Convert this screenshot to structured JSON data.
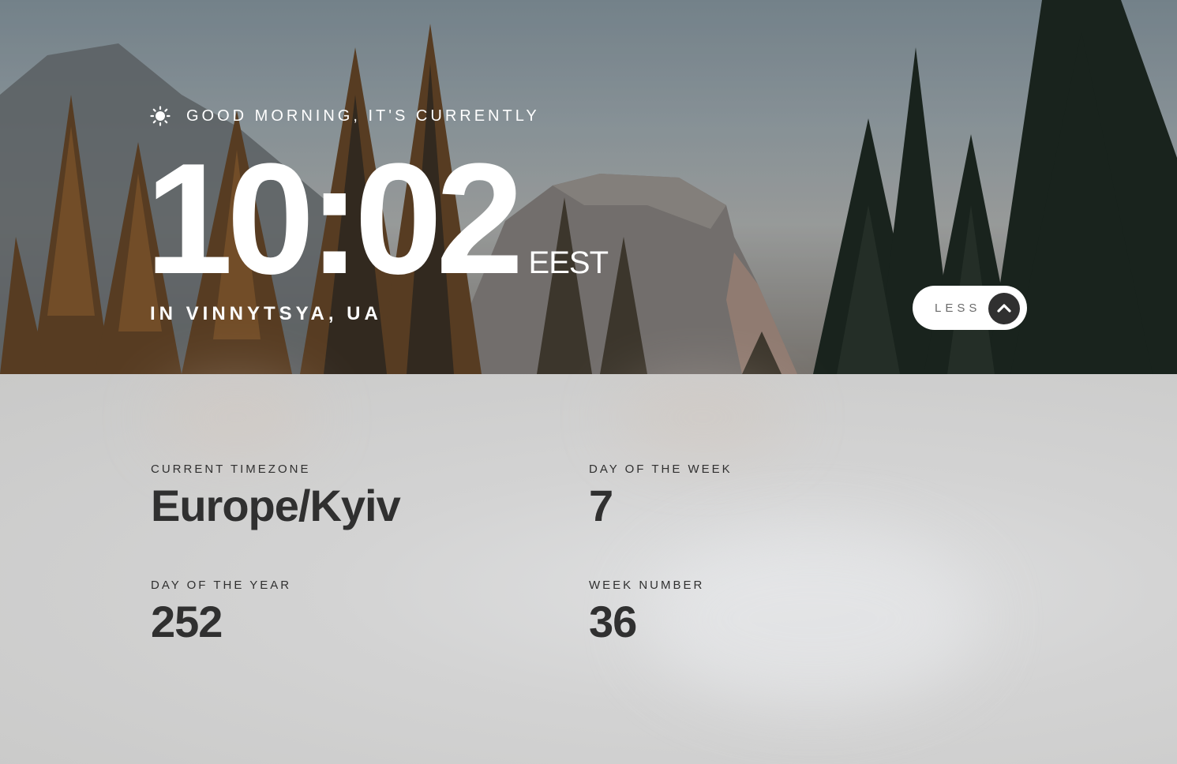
{
  "greeting": {
    "icon": "sun-icon",
    "text": "GOOD MORNING, IT'S CURRENTLY"
  },
  "clock": {
    "time": "10:02",
    "abbreviation": "EEST"
  },
  "location": "IN VINNYTSYA, UA",
  "toggle": {
    "label": "LESS",
    "icon": "chevron-up-icon"
  },
  "details": {
    "timezone": {
      "label": "CURRENT TIMEZONE",
      "value": "Europe/Kyiv"
    },
    "day_of_week": {
      "label": "DAY OF THE WEEK",
      "value": "7"
    },
    "day_of_year": {
      "label": "DAY OF THE YEAR",
      "value": "252"
    },
    "week_number": {
      "label": "WEEK NUMBER",
      "value": "36"
    }
  },
  "colors": {
    "text_light": "#ffffff",
    "text_dark": "#303030",
    "button_circle": "#303030",
    "button_label": "#6b6b6b"
  }
}
